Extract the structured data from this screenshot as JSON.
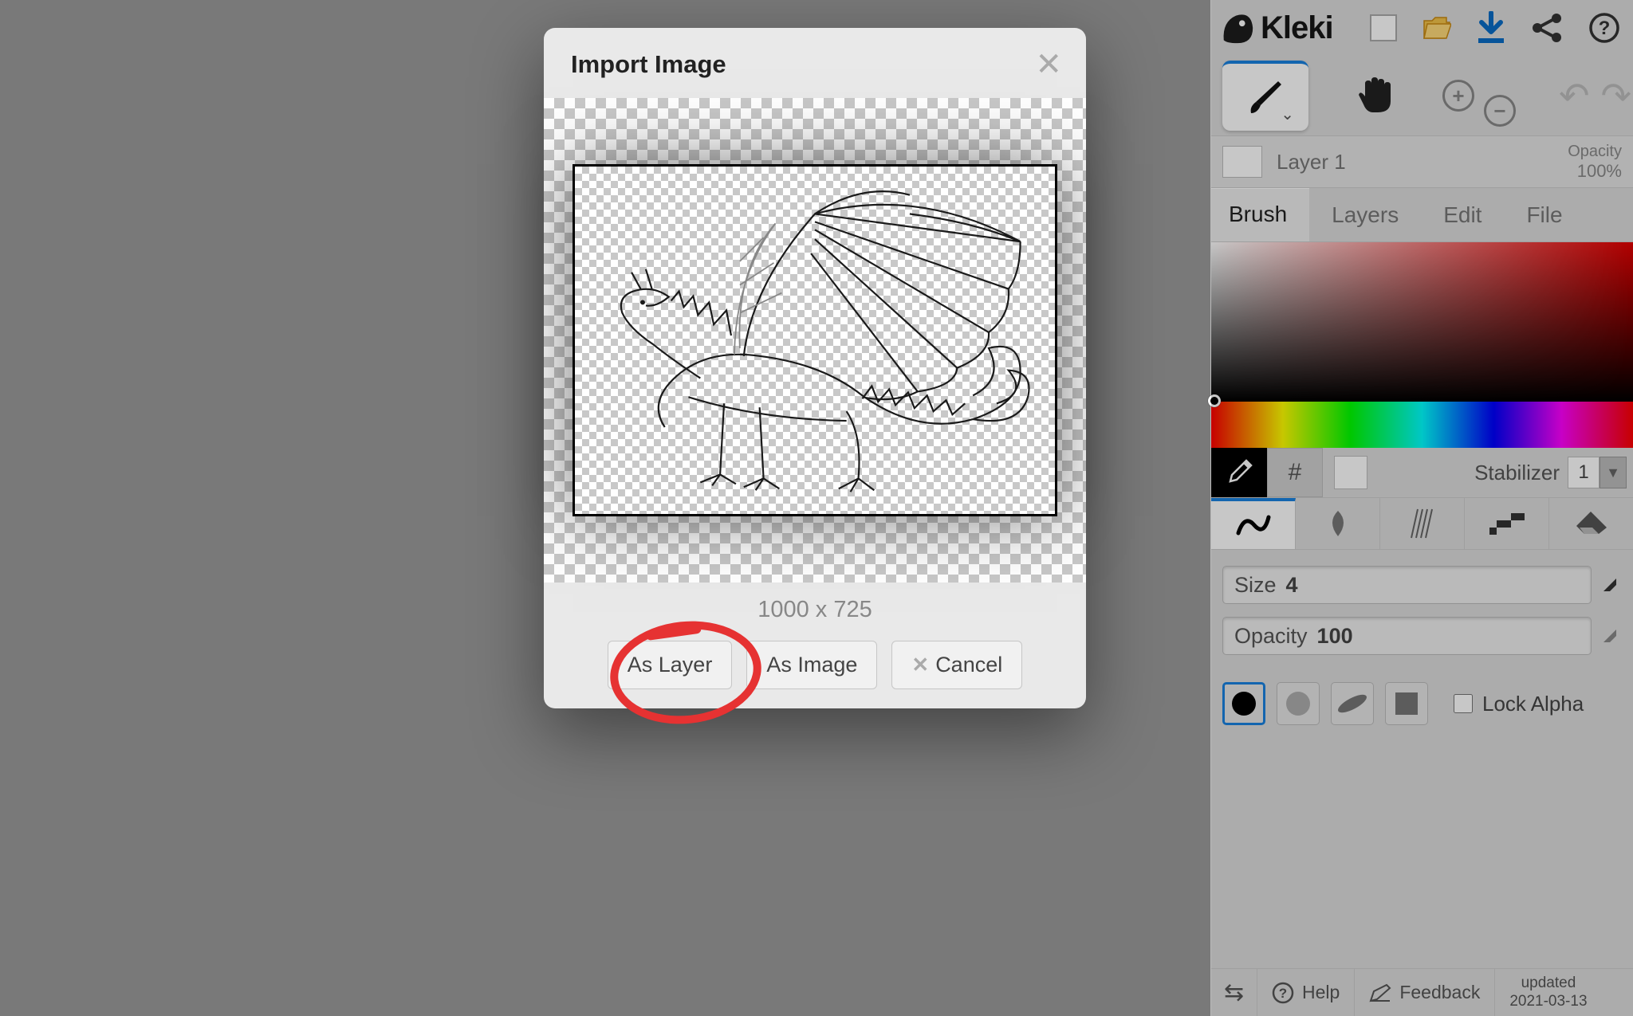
{
  "brand": {
    "name": "Kleki"
  },
  "dialog": {
    "title": "Import Image",
    "dimensions": "1000 x 725",
    "as_layer": "As Layer",
    "as_image": "As Image",
    "cancel": "Cancel"
  },
  "layer": {
    "name": "Layer 1",
    "opacity_label": "Opacity",
    "opacity_value": "100%"
  },
  "tabs": {
    "brush": "Brush",
    "layers": "Layers",
    "edit": "Edit",
    "file": "File"
  },
  "stabilizer": {
    "label": "Stabilizer",
    "value": "1"
  },
  "sliders": {
    "size_label": "Size",
    "size_value": "4",
    "opacity_label": "Opacity",
    "opacity_value": "100"
  },
  "lock_alpha": "Lock Alpha",
  "bottom": {
    "help": "Help",
    "feedback": "Feedback",
    "updated_lbl": "updated",
    "updated_date": "2021-03-13"
  }
}
